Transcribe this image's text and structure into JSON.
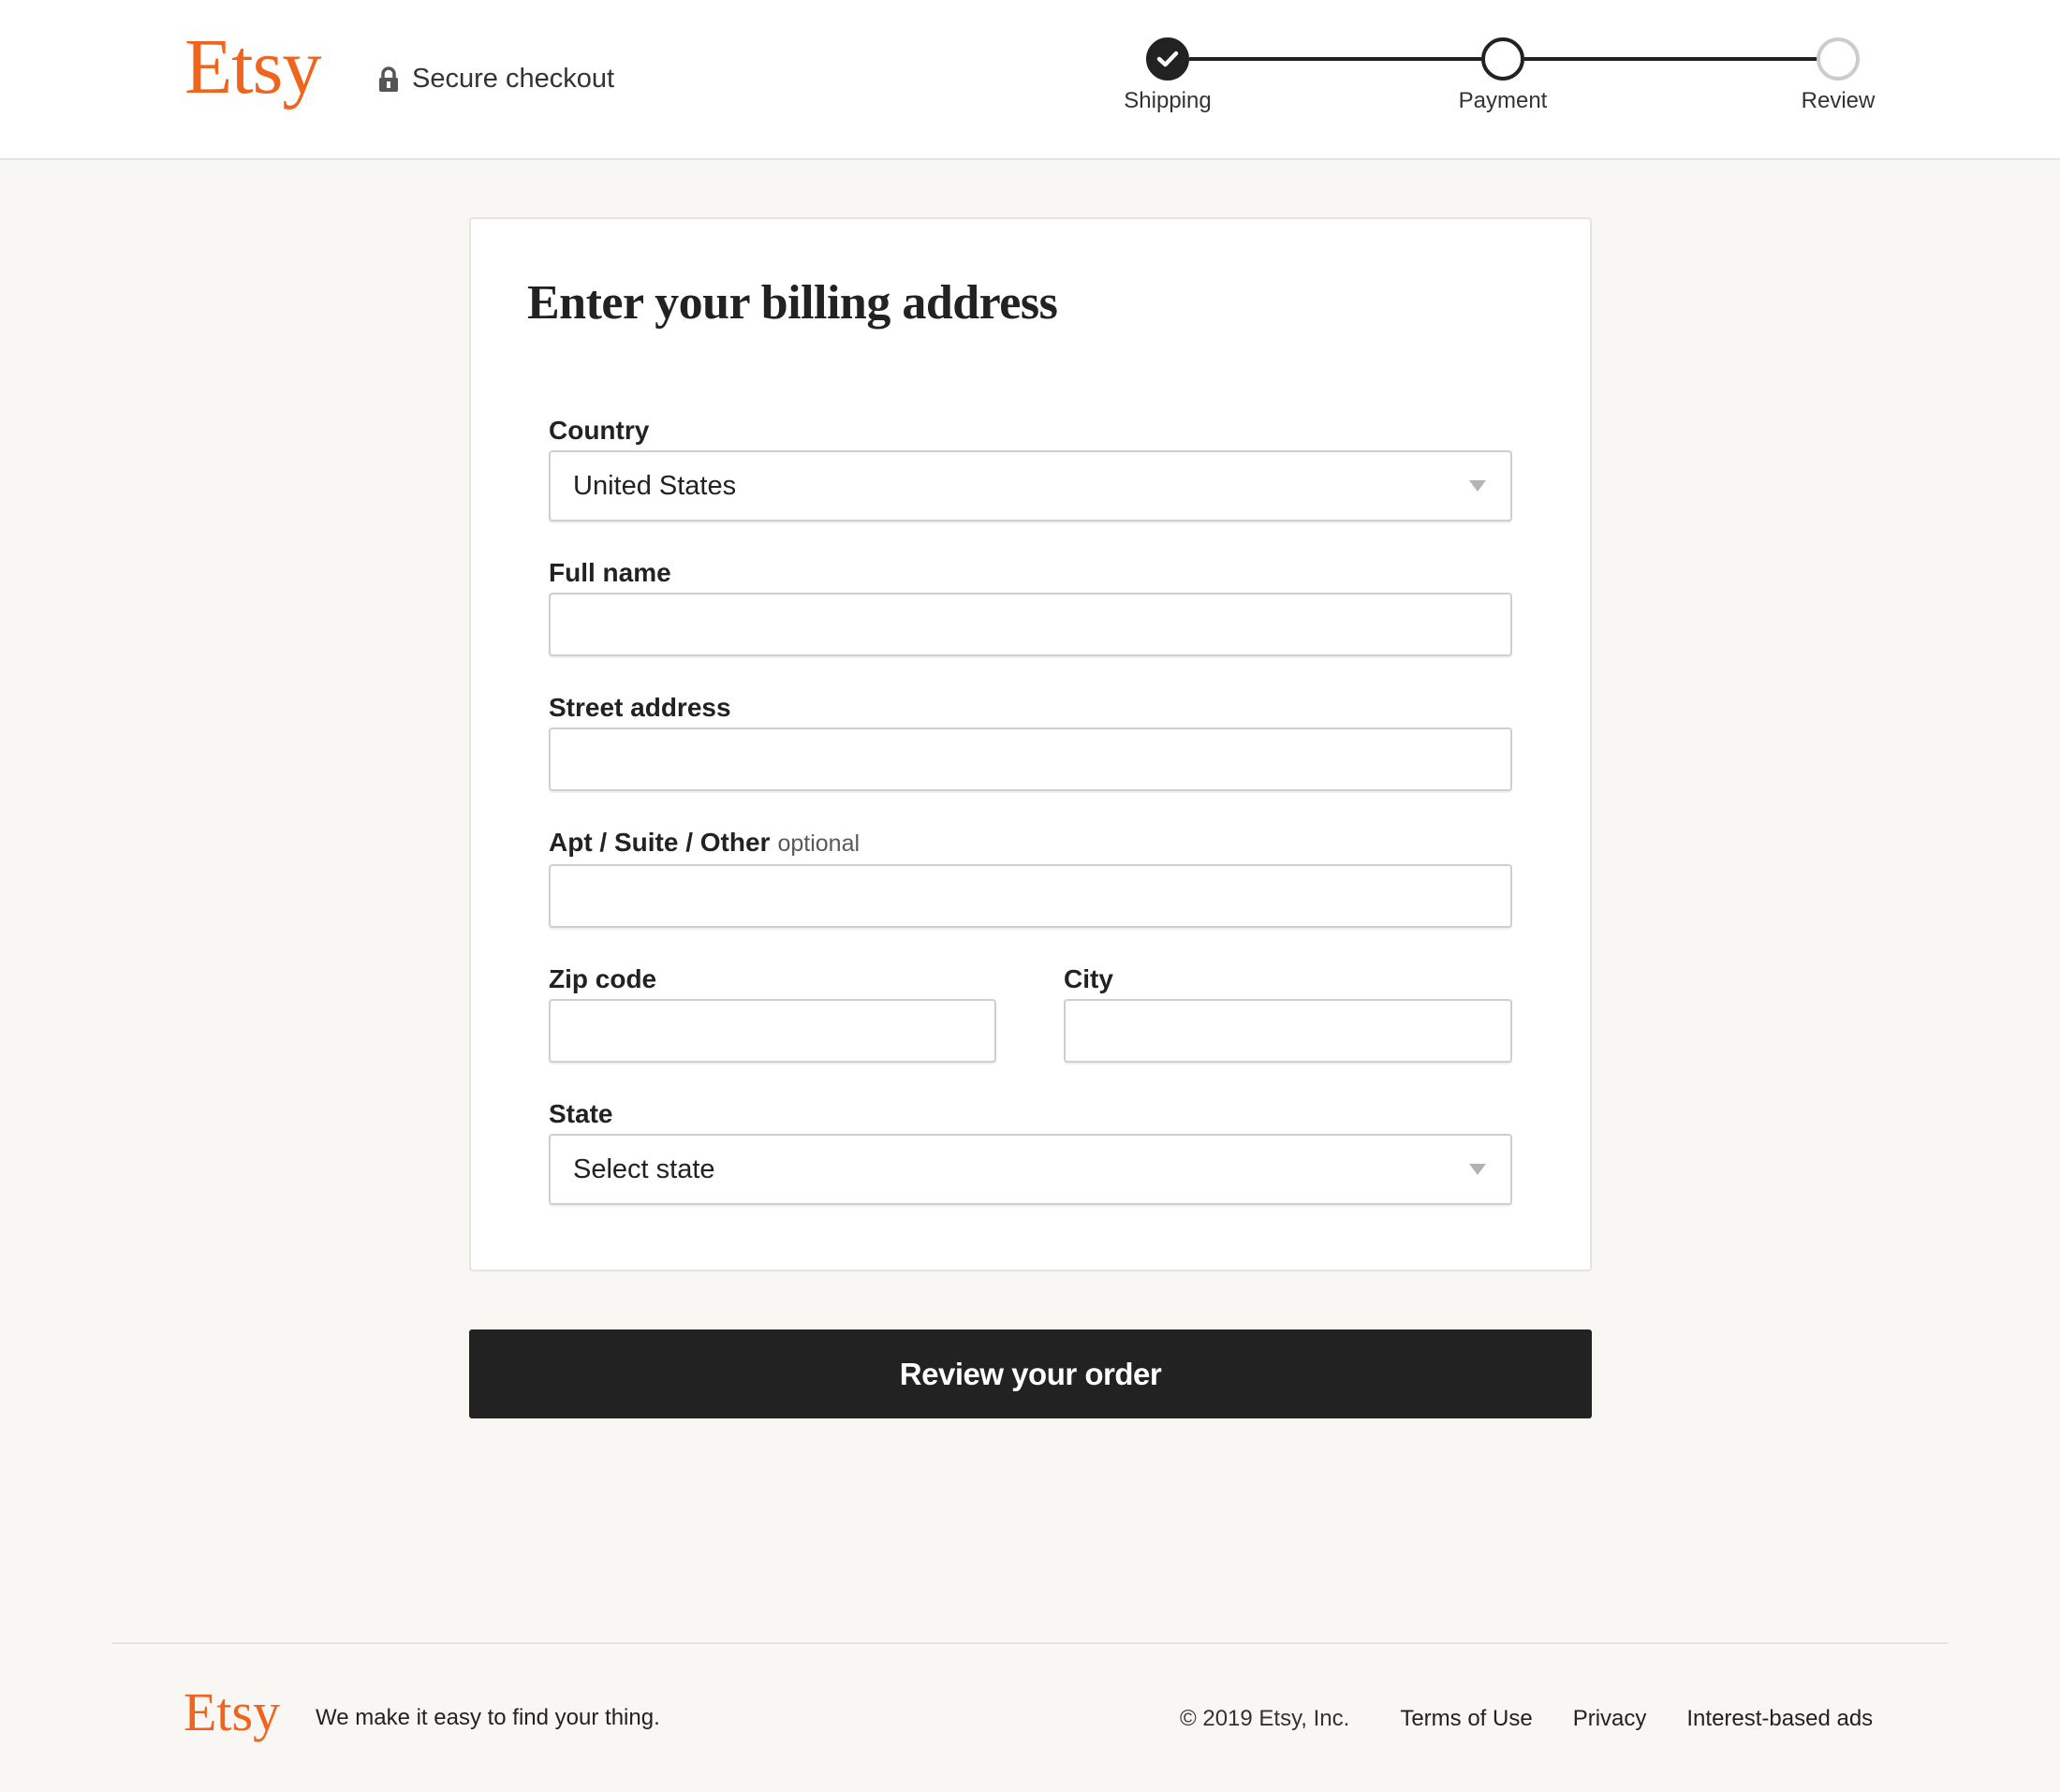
{
  "header": {
    "logo_text": "Etsy",
    "secure_checkout_label": "Secure checkout",
    "brand_color": "#f1641e",
    "steps": [
      {
        "label": "Shipping",
        "status": "completed"
      },
      {
        "label": "Payment",
        "status": "current"
      },
      {
        "label": "Review",
        "status": "upcoming"
      }
    ]
  },
  "form": {
    "title": "Enter your billing address",
    "country": {
      "label": "Country",
      "value": "United States"
    },
    "full_name": {
      "label": "Full name",
      "value": ""
    },
    "street_address": {
      "label": "Street address",
      "value": ""
    },
    "apt": {
      "label": "Apt / Suite / Other",
      "optional_tag": "optional",
      "value": ""
    },
    "zip": {
      "label": "Zip code",
      "value": ""
    },
    "city": {
      "label": "City",
      "value": ""
    },
    "state": {
      "label": "State",
      "value": "Select state"
    }
  },
  "actions": {
    "review_order_label": "Review your order"
  },
  "footer": {
    "logo_text": "Etsy",
    "tagline": "We make it easy to find your thing.",
    "copyright": "© 2019 Etsy, Inc.",
    "links": [
      "Terms of Use",
      "Privacy",
      "Interest-based ads"
    ]
  }
}
